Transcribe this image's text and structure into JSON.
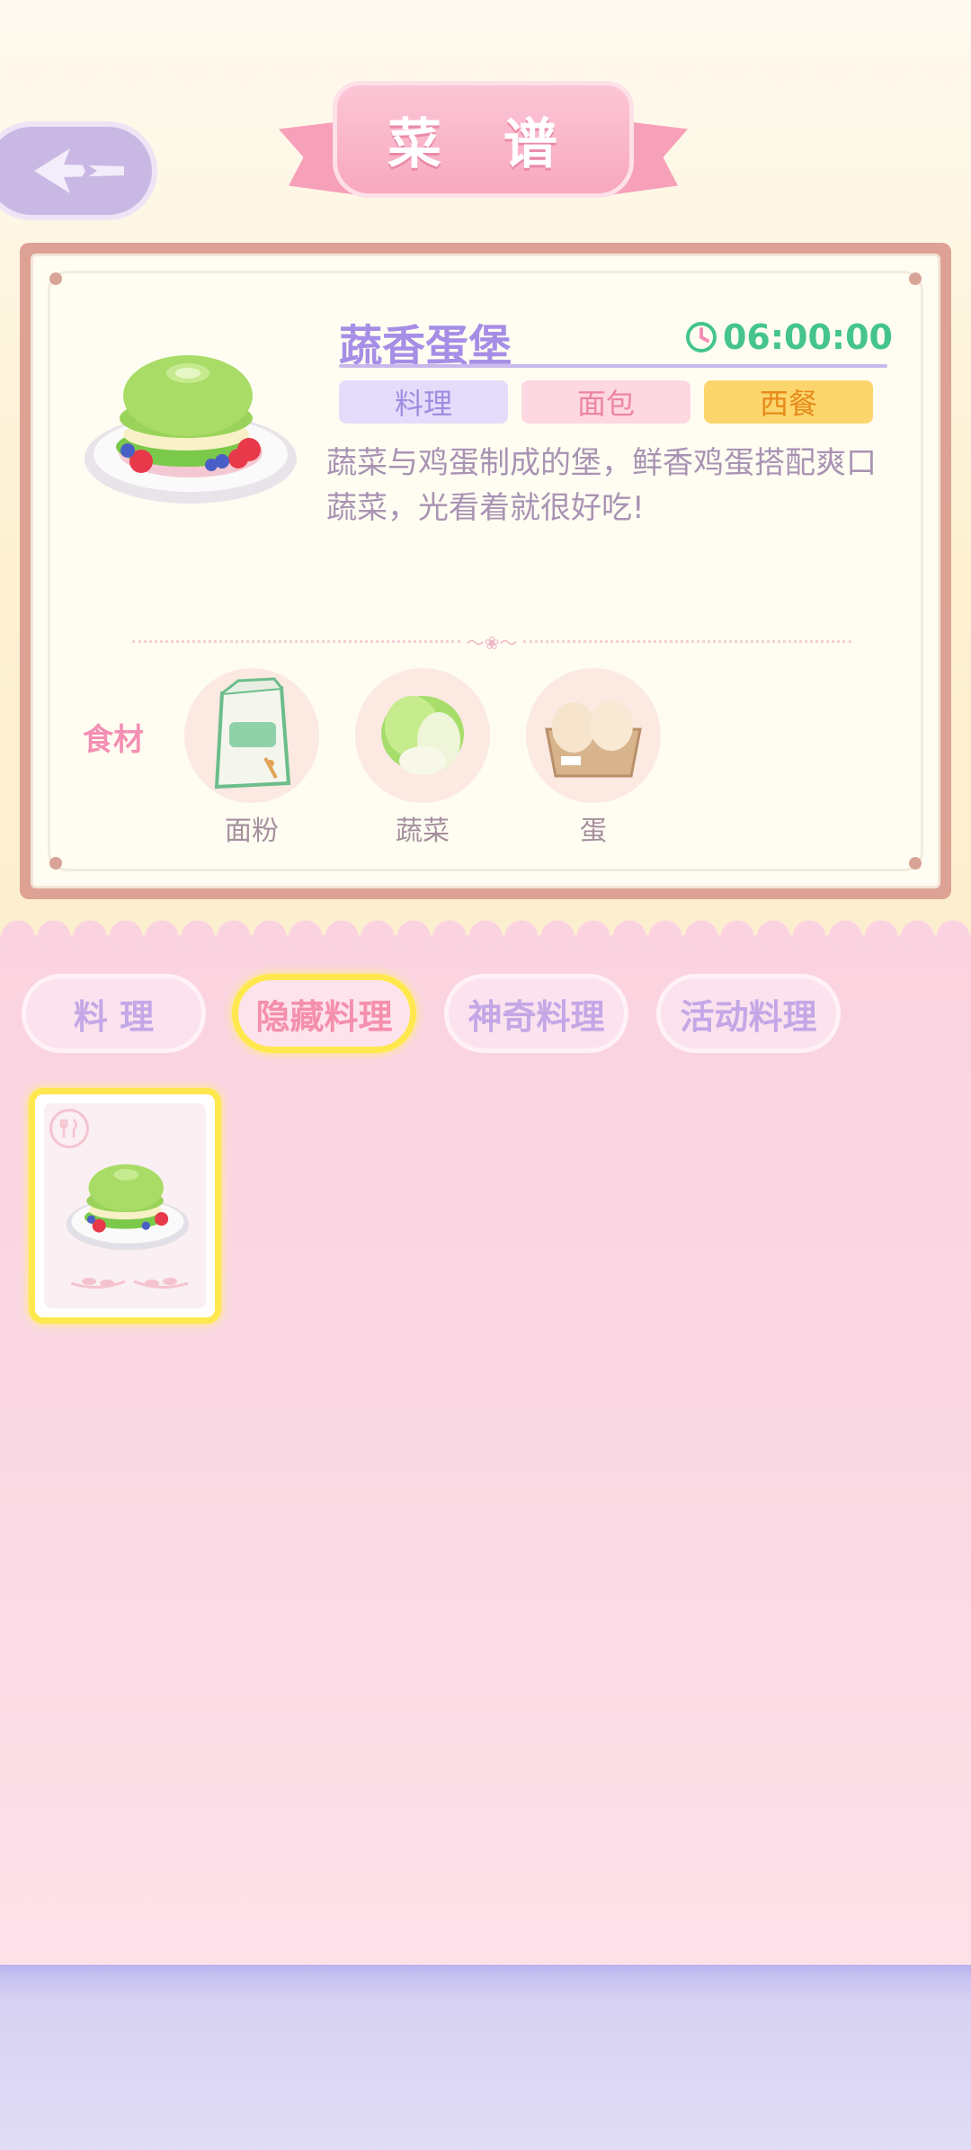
{
  "header": {
    "title": "菜 谱"
  },
  "recipe": {
    "name": "蔬香蛋堡",
    "time": "06:00:00",
    "tags": [
      "料理",
      "面包",
      "西餐"
    ],
    "description": "蔬菜与鸡蛋制成的堡，鲜香鸡蛋搭配爽口蔬菜，光看着就很好吃!",
    "ingredients_label": "食材",
    "ingredients": [
      {
        "name": "面粉",
        "icon": "flour-bag-icon"
      },
      {
        "name": "蔬菜",
        "icon": "cabbage-icon"
      },
      {
        "name": "蛋",
        "icon": "egg-carton-icon"
      }
    ]
  },
  "tabs": [
    {
      "label": "料 理",
      "active": false
    },
    {
      "label": "隐藏料理",
      "active": true
    },
    {
      "label": "神奇料理",
      "active": false
    },
    {
      "label": "活动料理",
      "active": false
    }
  ],
  "colors": {
    "accent_yellow": "#ffe84d",
    "title_purple": "#a68ee6",
    "timer_green": "#45c48c",
    "pink": "#f48fb3"
  }
}
